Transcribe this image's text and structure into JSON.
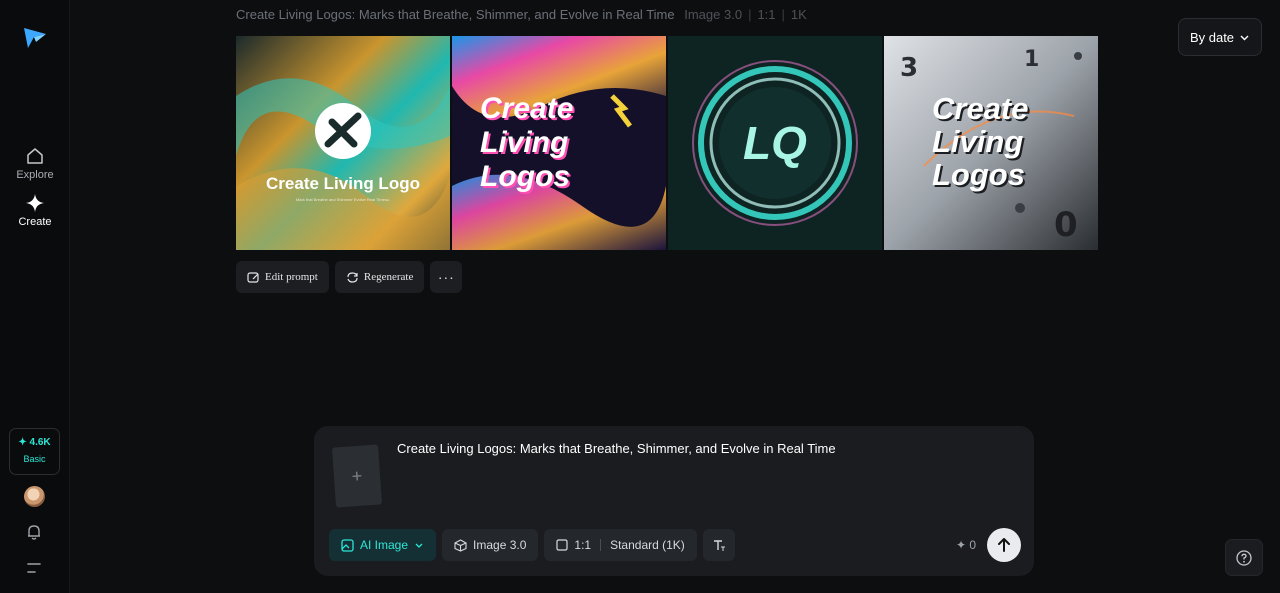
{
  "sidebar": {
    "items": [
      {
        "label": "Explore",
        "icon": "home-icon"
      },
      {
        "label": "Create",
        "icon": "sparkle-icon"
      }
    ],
    "credits": {
      "amount": "✦ 4.6K",
      "plan": "Basic"
    }
  },
  "header": {
    "prompt": "Create Living Logos: Marks that Breathe, Shimmer, and Evolve in Real Time",
    "model": "Image 3.0",
    "ratio": "1:1",
    "resolution": "1K",
    "sort_label": "By date"
  },
  "gallery": {
    "images": [
      {
        "headline": "Create Living Logo",
        "subline": "Mark that Breathe and Shimmer Evolve Real Timesc."
      },
      {
        "headline": "Create Living Logos"
      },
      {
        "headline": "LQ"
      },
      {
        "headline": "Create Living Logos"
      }
    ]
  },
  "actions": {
    "edit_prompt": "Edit prompt",
    "regenerate": "Regenerate",
    "more": "···"
  },
  "composer": {
    "text": "Create Living Logos: Marks that Breathe, Shimmer, and Evolve in Real Time",
    "upload_glyph": "+",
    "mode": "AI Image",
    "model": "Image 3.0",
    "ratio": "1:1",
    "quality": "Standard (1K)",
    "cost": "✦ 0"
  },
  "colors": {
    "accent": "#2ee6d6",
    "background": "#0d0e10",
    "panel": "#1a1c20"
  }
}
